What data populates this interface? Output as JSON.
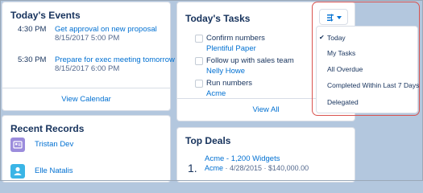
{
  "events": {
    "title": "Today's Events",
    "items": [
      {
        "time": "4:30 PM",
        "title": "Get approval on new proposal",
        "date": "8/15/2017 5:00 PM"
      },
      {
        "time": "5:30 PM",
        "title": "Prepare for exec meeting tomorrow",
        "date": "8/15/2017 6:00 PM"
      }
    ],
    "footer": "View Calendar"
  },
  "records": {
    "title": "Recent Records",
    "items": [
      {
        "name": "Tristan Dev",
        "icon": "contact-icon",
        "color": "#9b8cdc"
      },
      {
        "name": "Elle Natalis",
        "icon": "person-icon",
        "color": "#3ab5e6"
      }
    ]
  },
  "tasks": {
    "title": "Today's Tasks",
    "items": [
      {
        "label": "Confirm numbers",
        "sub": "Plentiful Paper"
      },
      {
        "label": "Follow up with sales team",
        "sub": "Nelly Howe"
      },
      {
        "label": "Run numbers",
        "sub": "Acme"
      }
    ],
    "footer": "View All"
  },
  "deals": {
    "title": "Top Deals",
    "number": "1.",
    "deal_title": "Acme - 1,200 Widgets",
    "account": "Acme",
    "meta": " · 4/28/2015 · $140,000.00"
  },
  "menu": {
    "selected": "Today",
    "items": [
      "Today",
      "My Tasks",
      "All Overdue",
      "Completed Within Last 7 Days",
      "Delegated"
    ]
  },
  "colors": {
    "link": "#0070d2",
    "highlight": "#d9534f",
    "text": "#16325c"
  }
}
